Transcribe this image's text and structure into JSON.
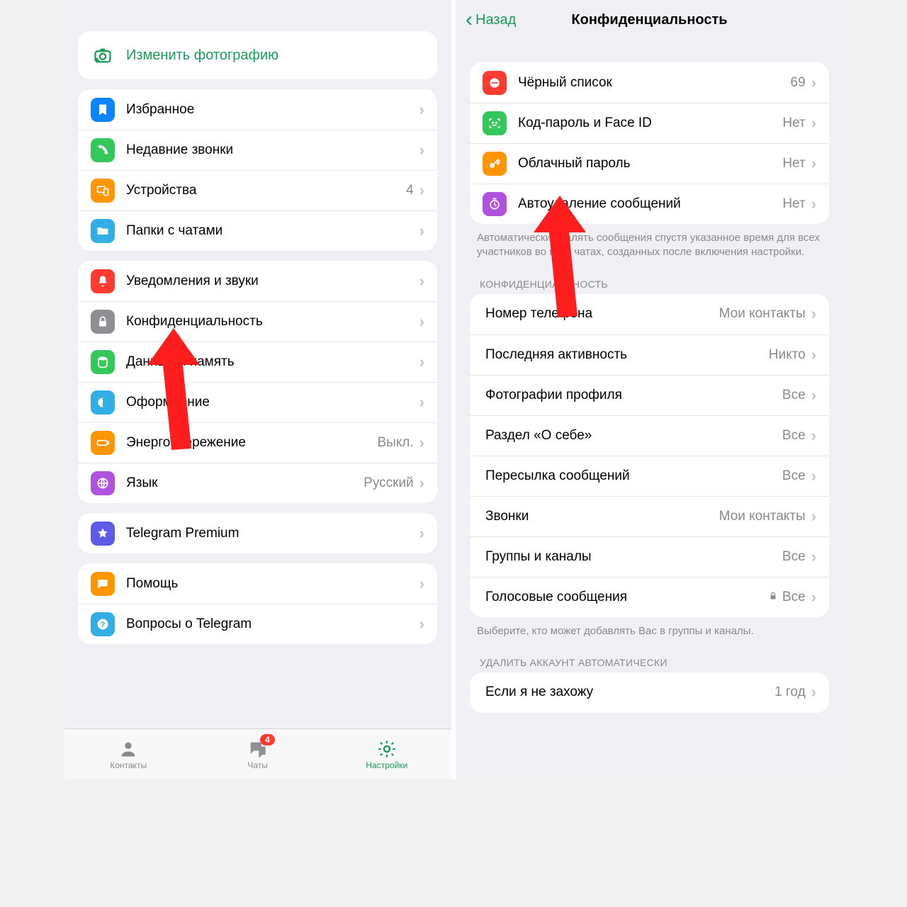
{
  "left": {
    "change_photo": "Изменить фотографию",
    "g1": {
      "fav": "Избранное",
      "calls": "Недавние звонки",
      "devices": "Устройства",
      "devices_val": "4",
      "folders": "Папки с чатами"
    },
    "g2": {
      "notif": "Уведомления и звуки",
      "privacy": "Конфиденциальность",
      "data": "Данные и память",
      "appearance": "Оформление",
      "power": "Энергосбережение",
      "power_val": "Выкл.",
      "lang": "Язык",
      "lang_val": "Русский"
    },
    "g3": {
      "premium": "Telegram Premium"
    },
    "g4": {
      "help": "Помощь",
      "faq": "Вопросы о Telegram"
    },
    "tabs": {
      "contacts": "Контакты",
      "chats": "Чаты",
      "chats_badge": "4",
      "settings": "Настройки"
    }
  },
  "right": {
    "back": "Назад",
    "title": "Конфиденциальность",
    "g1": {
      "block": "Чёрный список",
      "block_val": "69",
      "pass": "Код-пароль и Face ID",
      "pass_val": "Нет",
      "cloud": "Облачный пароль",
      "cloud_val": "Нет",
      "auto": "Автоудаление сообщений",
      "auto_val": "Нет"
    },
    "g1_footer": "Автоматически удалять сообщения спустя указанное время для всех участников во всех чатах, созданных после включения настройки.",
    "sect_privacy": "КОНФИДЕНЦИАЛЬНОСТЬ",
    "g2": {
      "phone": "Номер телефона",
      "phone_val": "Мои контакты",
      "last": "Последняя активность",
      "last_val": "Никто",
      "photos": "Фотографии профиля",
      "photos_val": "Все",
      "about": "Раздел «О себе»",
      "about_val": "Все",
      "fwd": "Пересылка сообщений",
      "fwd_val": "Все",
      "calls": "Звонки",
      "calls_val": "Мои контакты",
      "groups": "Группы и каналы",
      "groups_val": "Все",
      "voice": "Голосовые сообщения",
      "voice_val": "Все"
    },
    "g2_footer": "Выберите, кто может добавлять Вас в группы и каналы.",
    "sect_delete": "УДАЛИТЬ АККАУНТ АВТОМАТИЧЕСКИ",
    "g3": {
      "away": "Если я не захожу",
      "away_val": "1 год"
    }
  }
}
